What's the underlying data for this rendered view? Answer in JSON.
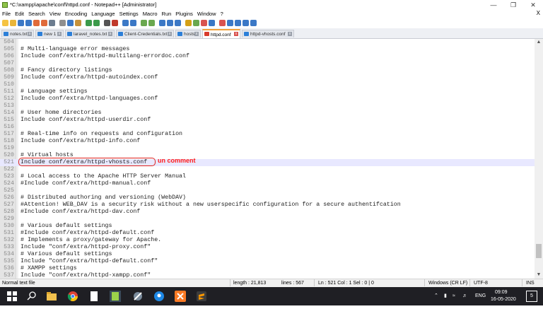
{
  "window": {
    "title": "*C:\\xampp\\apache\\conf\\httpd.conf - Notepad++ [Administrator]",
    "close_symbol": "X"
  },
  "menu": [
    "File",
    "Edit",
    "Search",
    "View",
    "Encoding",
    "Language",
    "Settings",
    "Macro",
    "Run",
    "Plugins",
    "Window",
    "?"
  ],
  "tabs": [
    "notes.txt",
    "new 1",
    "laravel_notes.txt",
    "Client-Credentials.txt",
    "hosts",
    "httpd.conf",
    "httpd-vhosts.conf"
  ],
  "active_tab": "httpd.conf",
  "editor": {
    "lines": [
      {
        "n": "504",
        "t": ""
      },
      {
        "n": "505",
        "t": "# Multi-language error messages"
      },
      {
        "n": "506",
        "t": "Include conf/extra/httpd-multilang-errordoc.conf"
      },
      {
        "n": "507",
        "t": ""
      },
      {
        "n": "508",
        "t": "# Fancy directory listings"
      },
      {
        "n": "509",
        "t": "Include conf/extra/httpd-autoindex.conf"
      },
      {
        "n": "510",
        "t": ""
      },
      {
        "n": "511",
        "t": "# Language settings"
      },
      {
        "n": "512",
        "t": "Include conf/extra/httpd-languages.conf"
      },
      {
        "n": "513",
        "t": ""
      },
      {
        "n": "514",
        "t": "# User home directories"
      },
      {
        "n": "515",
        "t": "Include conf/extra/httpd-userdir.conf"
      },
      {
        "n": "516",
        "t": ""
      },
      {
        "n": "517",
        "t": "# Real-time info on requests and configuration"
      },
      {
        "n": "518",
        "t": "Include conf/extra/httpd-info.conf"
      },
      {
        "n": "519",
        "t": ""
      },
      {
        "n": "520",
        "t": "# Virtual hosts"
      },
      {
        "n": "521",
        "t": "Include conf/extra/httpd-vhosts.conf"
      },
      {
        "n": "522",
        "t": ""
      },
      {
        "n": "523",
        "t": "# Local access to the Apache HTTP Server Manual"
      },
      {
        "n": "524",
        "t": "#Include conf/extra/httpd-manual.conf"
      },
      {
        "n": "525",
        "t": ""
      },
      {
        "n": "526",
        "t": "# Distributed authoring and versioning (WebDAV)"
      },
      {
        "n": "527",
        "t": "#Attention! WEB_DAV is a security risk without a new userspecific configuration for a secure authentifcation"
      },
      {
        "n": "528",
        "t": "#Include conf/extra/httpd-dav.conf"
      },
      {
        "n": "529",
        "t": ""
      },
      {
        "n": "530",
        "t": "# Various default settings"
      },
      {
        "n": "531",
        "t": "#Include conf/extra/httpd-default.conf"
      },
      {
        "n": "532",
        "t": "# Implements a proxy/gateway for Apache."
      },
      {
        "n": "533",
        "t": "Include \"conf/extra/httpd-proxy.conf\""
      },
      {
        "n": "534",
        "t": "# Various default settings"
      },
      {
        "n": "535",
        "t": "Include \"conf/extra/httpd-default.conf\""
      },
      {
        "n": "536",
        "t": "# XAMPP settings"
      },
      {
        "n": "537",
        "t": "Include \"conf/extra/httpd-xampp.conf\""
      }
    ],
    "current_line": "521",
    "annotation": "un comment"
  },
  "status": {
    "file_type": "Normal text file",
    "length": "length : 21,813",
    "lines": "lines : 567",
    "position": "Ln : 521    Col : 1    Sel : 0 | 0",
    "eol": "Windows (CR LF)",
    "encoding": "UTF-8",
    "mode": "INS"
  },
  "taskbar": {
    "tray_lang": "ENG",
    "time": "09:09",
    "date": "16-05-2020",
    "notif_count": "5"
  },
  "colors": {
    "annotation": "#ff1a1a",
    "current_line_bg": "#e8e8ff",
    "taskbar_bg": "#1f1f24"
  }
}
